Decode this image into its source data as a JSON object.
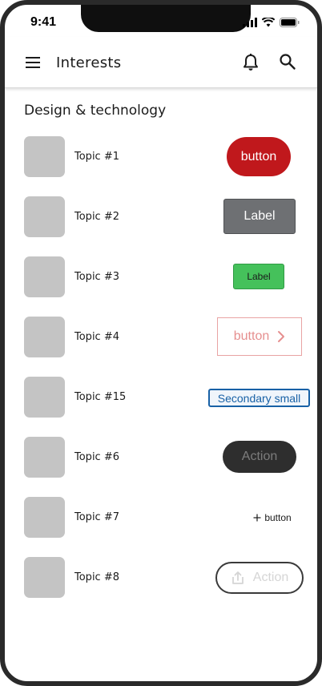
{
  "status_bar": {
    "time": "9:41"
  },
  "app_bar": {
    "title": "Interests"
  },
  "section": {
    "title": "Design & technology"
  },
  "topics": [
    {
      "label": "Topic #1",
      "button": "button"
    },
    {
      "label": "Topic #2",
      "button": "Label"
    },
    {
      "label": "Topic #3",
      "button": "Label"
    },
    {
      "label": "Topic #4",
      "button": "button"
    },
    {
      "label": "Topic #15",
      "button": "Secondary small"
    },
    {
      "label": "Topic #6",
      "button": "Action"
    },
    {
      "label": "Topic #7",
      "button": "button"
    },
    {
      "label": "Topic #8",
      "button": "Action"
    }
  ],
  "colors": {
    "red_button": "#c0181c",
    "grey_button": "#6e7073",
    "green_button": "#45c15b",
    "pink_outline": "#e68f8f",
    "secondary_blue": "#1861a6",
    "dark_button": "#2e2e2e",
    "thumbnail": "#c4c4c4"
  }
}
